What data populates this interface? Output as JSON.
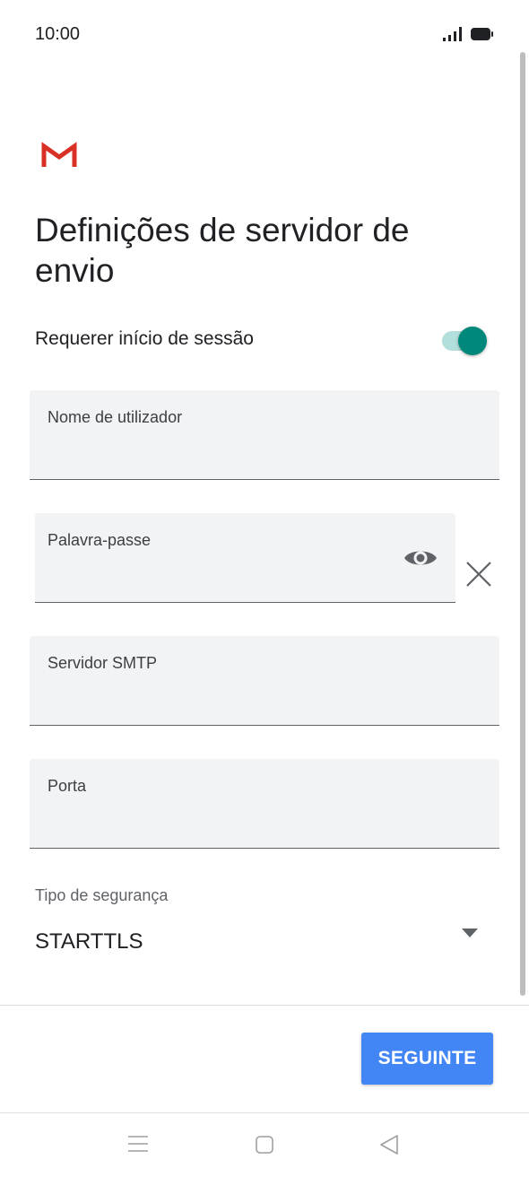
{
  "status_bar": {
    "time": "10:00",
    "icons": [
      "signal-icon",
      "battery-icon"
    ]
  },
  "header": {
    "logo": "gmail-logo",
    "title": "Definições de servidor de envio"
  },
  "require_signin": {
    "label": "Requerer início de sessão",
    "enabled": true
  },
  "fields": {
    "username": {
      "label": "Nome de utilizador",
      "value": ""
    },
    "password": {
      "label": "Palavra-passe",
      "value": ""
    },
    "smtp_server": {
      "label": "Servidor SMTP",
      "value": ""
    },
    "port": {
      "label": "Porta",
      "value": ""
    }
  },
  "security": {
    "label": "Tipo de segurança",
    "value": "STARTTLS"
  },
  "actions": {
    "next_label": "SEGUINTE"
  },
  "nav_bar": {
    "icons": [
      "menu-icon",
      "home-icon",
      "back-icon"
    ]
  },
  "colors": {
    "accent": "#00897b",
    "accent_track": "#b2dfdb",
    "button": "#4285f4",
    "field_bg": "#f1f3f4",
    "gmail_red": "#d93025"
  }
}
